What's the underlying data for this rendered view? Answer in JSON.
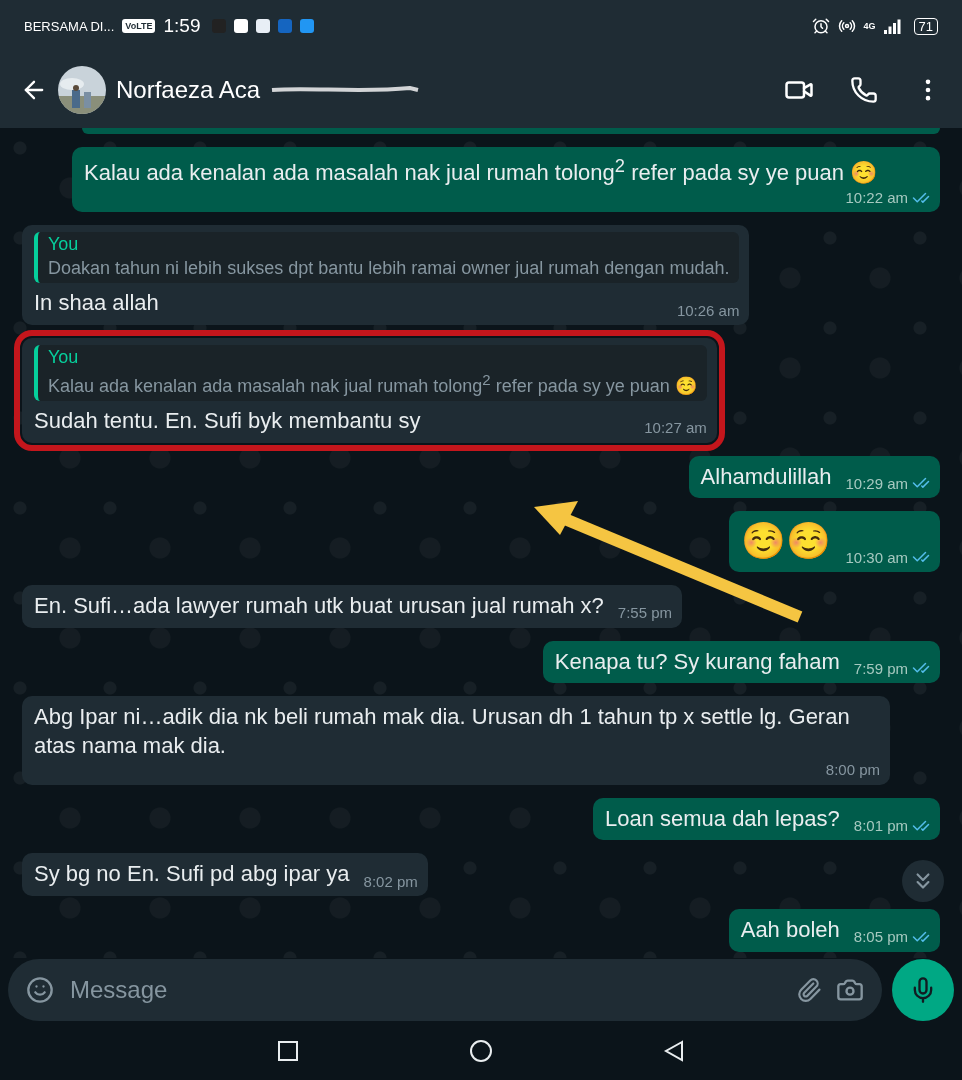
{
  "status_bar": {
    "carrier": "BERSAMA DI...",
    "volte": "VoLTE",
    "time": "1:59",
    "network": "4G",
    "battery": "71"
  },
  "header": {
    "name": "Norfaeza Aca"
  },
  "messages": [
    {
      "outgoing": true,
      "text": "Kalau ada kenalan ada masalah nak jual rumah tolong$^{2}$ refer pada sy ye puan ☺️",
      "time": "10:22 am",
      "read": true
    },
    {
      "outgoing": false,
      "quote": {
        "author": "You",
        "text": "Doakan tahun ni lebih sukses dpt bantu lebih ramai owner jual rumah dengan mudah."
      },
      "text": "In shaa allah",
      "time": "10:26 am"
    },
    {
      "outgoing": false,
      "quote": {
        "author": "You",
        "text": "Kalau ada kenalan ada masalah nak jual rumah tolong$^{2}$ refer pada sy ye puan ☺️"
      },
      "text": "Sudah tentu. En. Sufi byk membantu sy",
      "time": "10:27 am",
      "highlighted": true
    },
    {
      "outgoing": true,
      "text": "Alhamdulillah",
      "time": "10:29 am",
      "read": true
    },
    {
      "outgoing": true,
      "kind": "emoji",
      "text": "☺️☺️",
      "time": "10:30 am",
      "read": true
    },
    {
      "outgoing": false,
      "text": "En. Sufi…ada lawyer rumah utk buat urusan jual rumah x?",
      "time": "7:55 pm"
    },
    {
      "outgoing": true,
      "text": "Kenapa tu? Sy kurang faham",
      "time": "7:59 pm",
      "read": true
    },
    {
      "outgoing": false,
      "text": "Abg Ipar ni…adik dia nk beli rumah mak dia. Urusan dh 1 tahun tp x settle lg. Geran atas nama mak dia.",
      "time": "8:00 pm"
    },
    {
      "outgoing": true,
      "text": "Loan semua dah lepas?",
      "time": "8:01 pm",
      "read": true
    },
    {
      "outgoing": false,
      "text": "Sy bg no En. Sufi pd abg ipar ya",
      "time": "8:02 pm"
    },
    {
      "outgoing": true,
      "text": "Aah boleh",
      "time": "8:05 pm",
      "read": true
    }
  ],
  "composer": {
    "placeholder": "Message"
  }
}
